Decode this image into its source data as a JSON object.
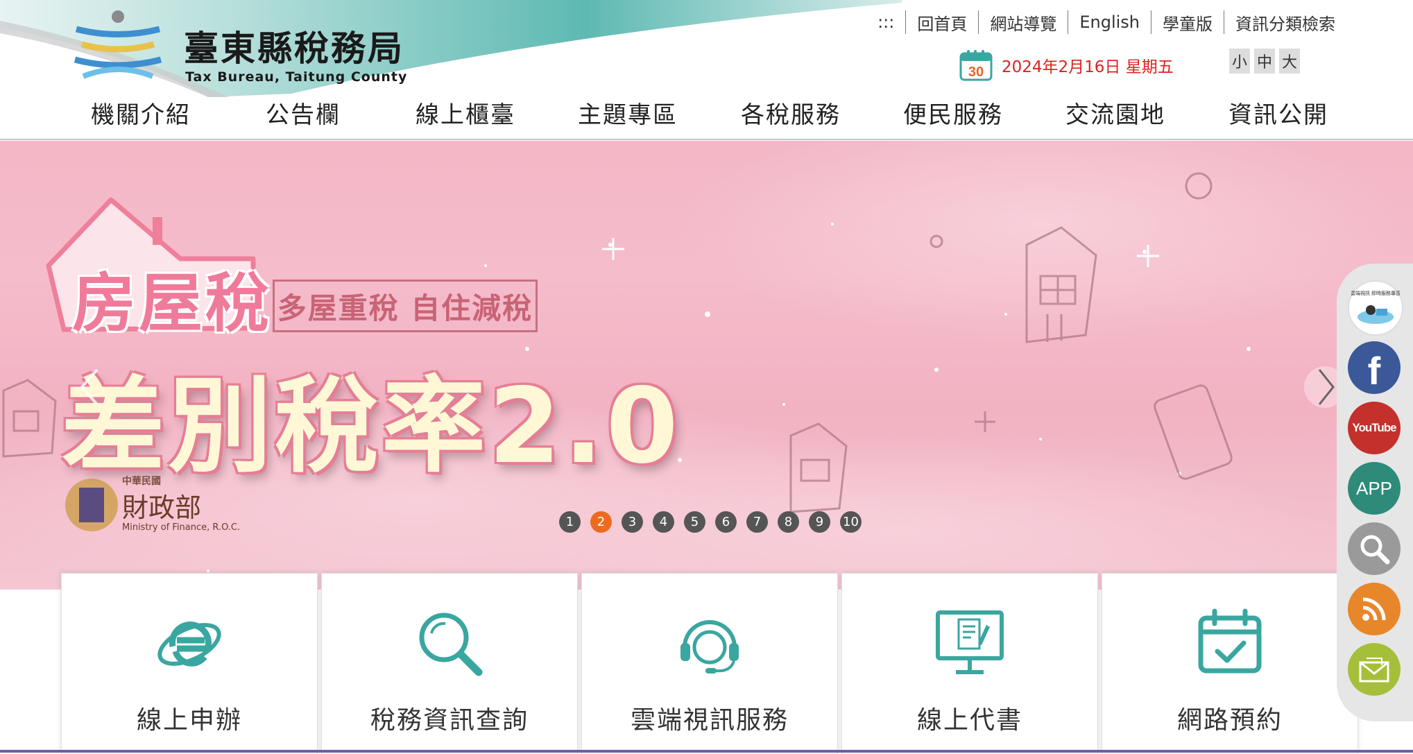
{
  "header": {
    "logo_title": "臺東縣稅務局",
    "logo_subtitle": "Tax Bureau, Taitung County",
    "top_links": [
      {
        "label": ":::"
      },
      {
        "label": "回首頁"
      },
      {
        "label": "網站導覽"
      },
      {
        "label": "English"
      },
      {
        "label": "學童版"
      },
      {
        "label": "資訊分類檢索"
      }
    ],
    "calendar_day": "30",
    "date": "2024年2月16日 星期五",
    "font_sizes": [
      "小",
      "中",
      "大"
    ]
  },
  "nav": {
    "items": [
      {
        "label": "機關介紹"
      },
      {
        "label": "公告欄"
      },
      {
        "label": "線上櫃臺"
      },
      {
        "label": "主題專區"
      },
      {
        "label": "各稅服務"
      },
      {
        "label": "便民服務"
      },
      {
        "label": "交流園地"
      },
      {
        "label": "資訊公開"
      }
    ]
  },
  "banner": {
    "house_label": "房屋稅",
    "slogan": "多屋重稅 自住減稅",
    "title": "差別稅率2.0",
    "mof_roc": "中華民國",
    "mof_name": "財政部",
    "mof_en": "Ministry of Finance, R.O.C.",
    "dots": [
      "1",
      "2",
      "3",
      "4",
      "5",
      "6",
      "7",
      "8",
      "9",
      "10"
    ],
    "active_dot": 2
  },
  "services": [
    {
      "label": "線上申辦",
      "icon": "internet-explorer-icon"
    },
    {
      "label": "稅務資訊查詢",
      "icon": "magnifier-icon"
    },
    {
      "label": "雲端視訊服務",
      "icon": "headset-icon"
    },
    {
      "label": "線上代書",
      "icon": "document-monitor-icon"
    },
    {
      "label": "網路預約",
      "icon": "calendar-check-icon"
    }
  ],
  "social": [
    {
      "name": "cloud-service-icon",
      "text": "雲端視訊 即時服務專區"
    },
    {
      "name": "facebook-icon",
      "text": "f"
    },
    {
      "name": "youtube-icon",
      "text": "YouTube"
    },
    {
      "name": "app-icon",
      "text": "APP"
    },
    {
      "name": "search-icon",
      "text": ""
    },
    {
      "name": "rss-icon",
      "text": ""
    },
    {
      "name": "mail-icon",
      "text": ""
    }
  ],
  "colors": {
    "accent_teal": "#3aa6a0",
    "date_red": "#e02020",
    "active_dot": "#ee6a1e",
    "facebook": "#3b5998",
    "youtube": "#c4302b",
    "app": "#2e8b7a",
    "search": "#999999",
    "rss": "#e8862a",
    "mail": "#a6bf3a"
  }
}
